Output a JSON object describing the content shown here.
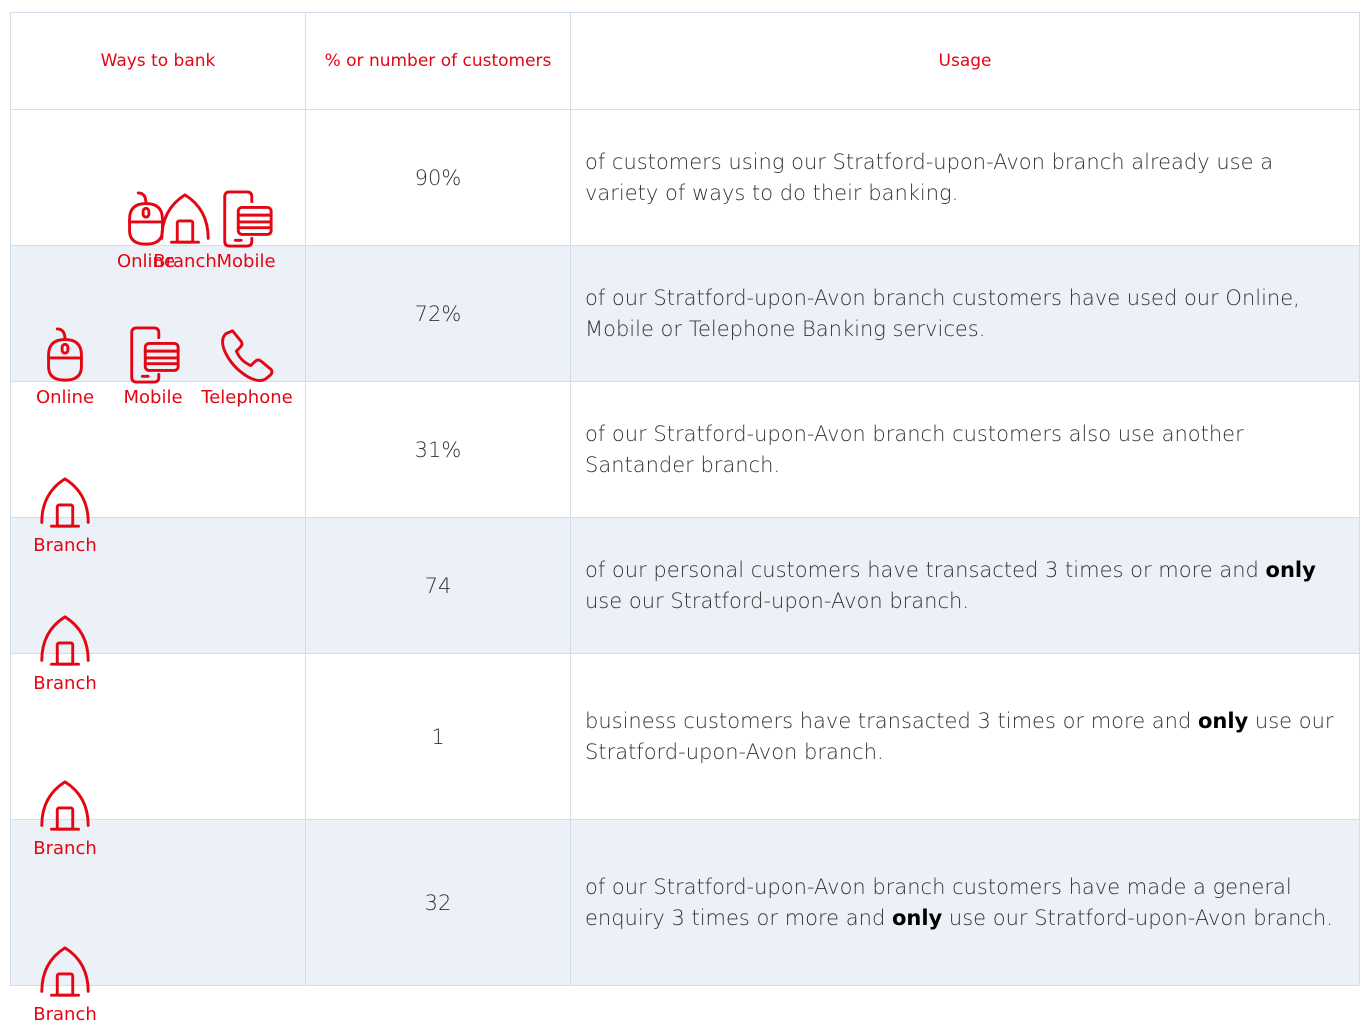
{
  "header": {
    "ways_to_bank": "Ways to bank",
    "customers": "% or number of customers",
    "usage": "Usage"
  },
  "icon_labels": {
    "branch": "Branch",
    "online": "Online",
    "mobile": "Mobile",
    "telephone": "Telephone"
  },
  "rows": [
    {
      "channels": [
        "branch",
        "online",
        "mobile"
      ],
      "value": "90%",
      "usage_pre": "of customers using our Stratford-upon-Avon branch already use a variety of ways to do their banking.",
      "usage_bold": "",
      "usage_post": ""
    },
    {
      "channels": [
        "online",
        "mobile",
        "telephone"
      ],
      "value": "72%",
      "usage_pre": "of our Stratford-upon-Avon branch customers have used our Online, Mobile or Telephone Banking services.",
      "usage_bold": "",
      "usage_post": ""
    },
    {
      "channels": [
        "branch"
      ],
      "value": "31%",
      "usage_pre": "of our Stratford-upon-Avon branch customers also use another Santander branch.",
      "usage_bold": "",
      "usage_post": ""
    },
    {
      "channels": [
        "branch"
      ],
      "value": "74",
      "usage_pre": "of our personal customers have transacted 3 times or more and ",
      "usage_bold": "only",
      "usage_post": " use our Stratford-upon-Avon branch."
    },
    {
      "channels": [
        "branch"
      ],
      "value": "1",
      "usage_pre": "business customers have transacted 3 times or more and ",
      "usage_bold": "only",
      "usage_post": " use our Stratford-upon-Avon branch."
    },
    {
      "channels": [
        "branch"
      ],
      "value": "32",
      "usage_pre": "of our Stratford-upon-Avon branch customers have made a general enquiry 3 times or more and ",
      "usage_bold": "only",
      "usage_post": " use our Stratford-upon-Avon branch."
    }
  ],
  "colors": {
    "accent": "#e30613",
    "row_alt": "#ecf1f8",
    "grid": "#d2dee9"
  }
}
